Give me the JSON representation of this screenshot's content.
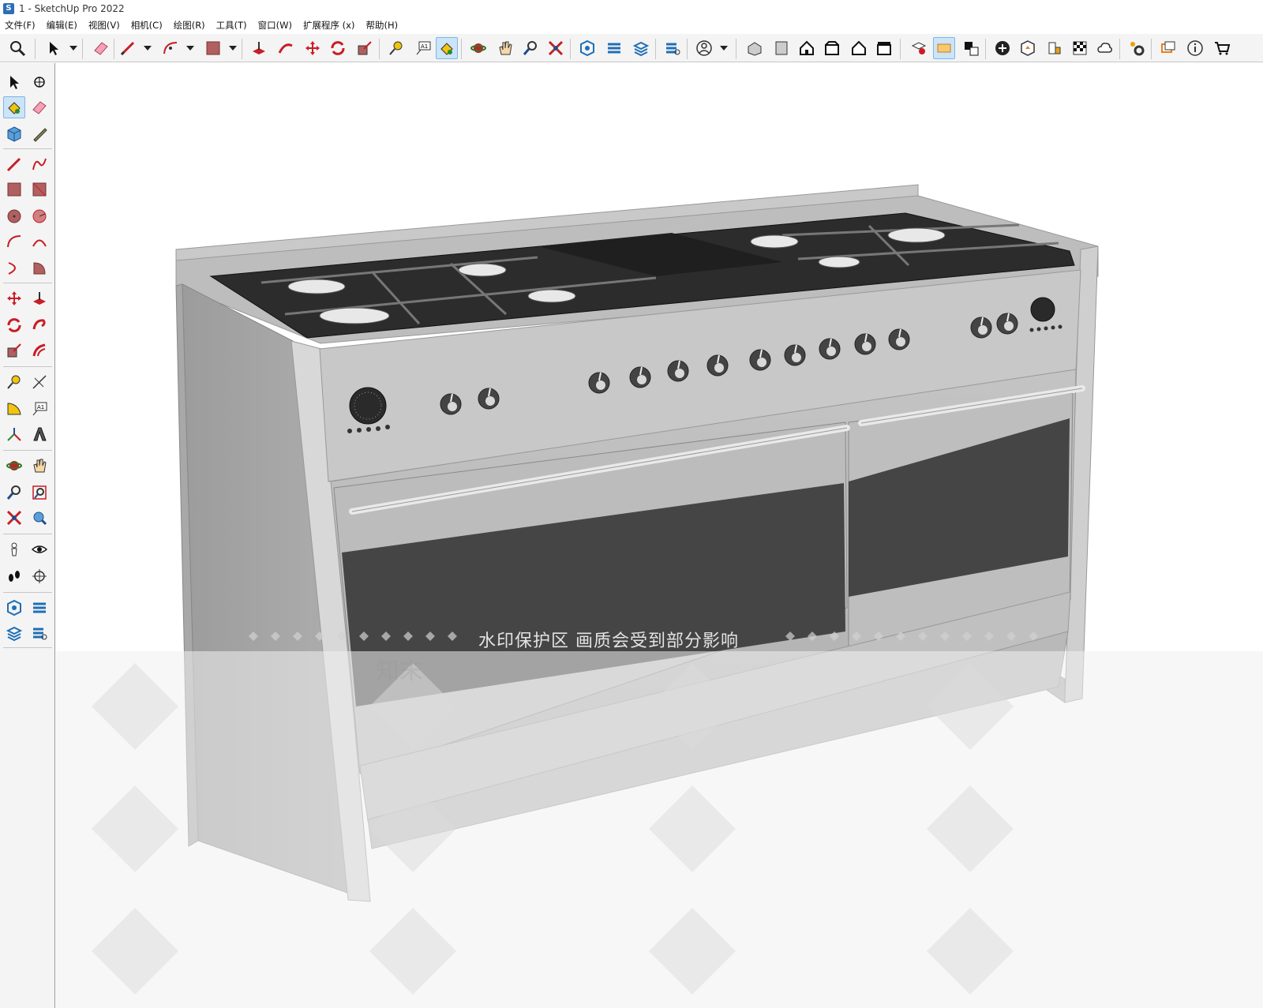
{
  "window": {
    "title": "1 - SketchUp Pro 2022"
  },
  "menu": [
    {
      "label": "文件(F)"
    },
    {
      "label": "编辑(E)"
    },
    {
      "label": "视图(V)"
    },
    {
      "label": "相机(C)"
    },
    {
      "label": "绘图(R)"
    },
    {
      "label": "工具(T)"
    },
    {
      "label": "窗口(W)"
    },
    {
      "label": "扩展程序 (x)"
    },
    {
      "label": "帮助(H)"
    }
  ],
  "toolbar": {
    "active_tool": "paint-bucket",
    "tools": [
      "zoom",
      "select",
      "eraser",
      "pencil",
      "arc",
      "rectangle",
      "push-pull",
      "follow-me",
      "move",
      "rotate",
      "scale",
      "tape-measure",
      "text",
      "paint-bucket",
      "orbit",
      "pan",
      "zoom-window",
      "zoom-extents",
      "warehouse",
      "extension-warehouse",
      "extension-manager",
      "account",
      "iso-view",
      "top-view",
      "front-view",
      "right-view",
      "back-view",
      "left-view",
      "section-plane",
      "tag",
      "style",
      "add-location",
      "sandbox",
      "shadow",
      "fog",
      "cloud",
      "solid-tools",
      "preferences",
      "message",
      "info",
      "cart"
    ]
  },
  "viewport": {
    "watermark_text": "水印保护区  画质会受到部分影响",
    "watermark_logo": "知末",
    "colors": {
      "steel": "#b4b4b4",
      "steel_dark": "#8e8e8e",
      "glass": "#454545",
      "grate": "#2c2c2c"
    }
  }
}
